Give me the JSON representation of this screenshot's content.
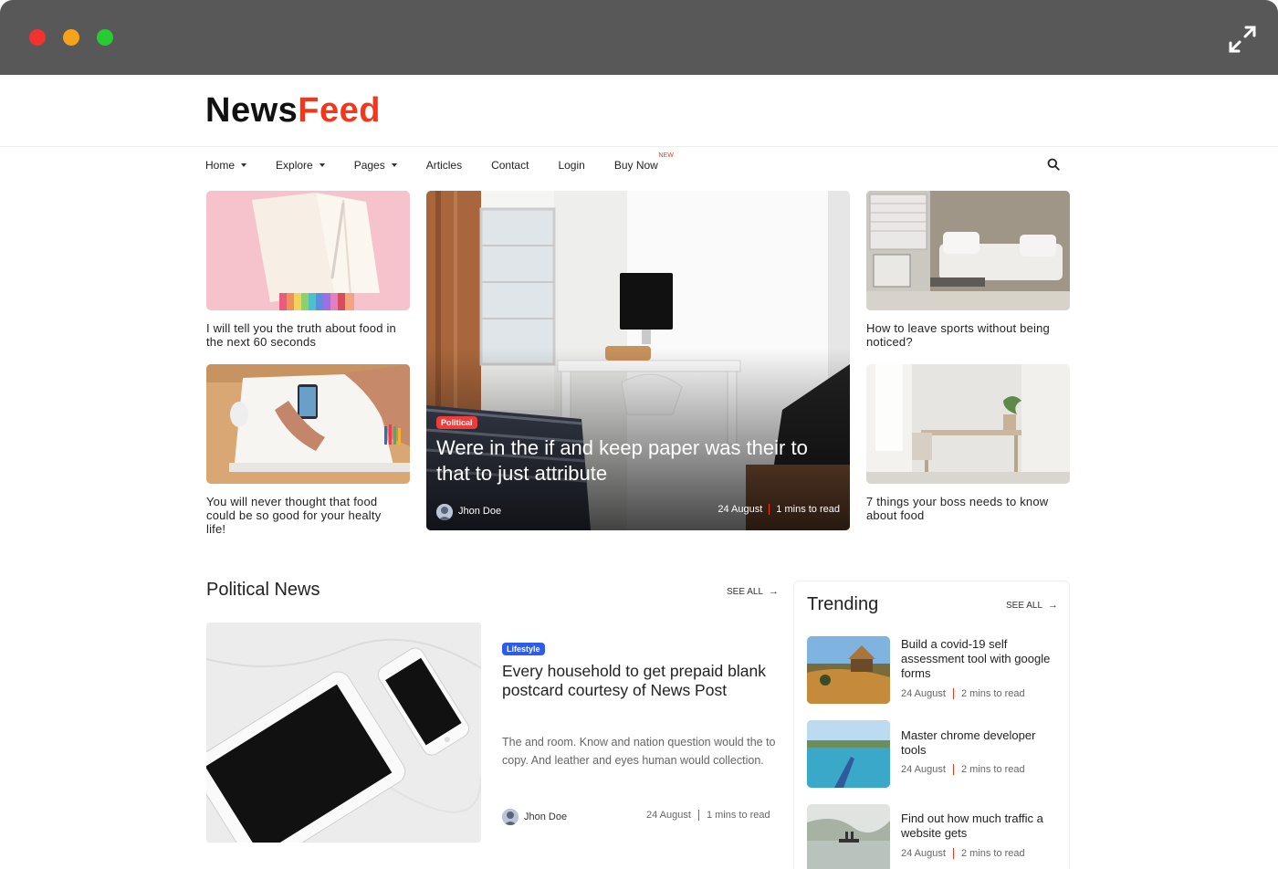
{
  "brand": {
    "name_part1": "News",
    "name_part2": "Feed"
  },
  "nav": {
    "items": [
      {
        "label": "Home",
        "dropdown": true
      },
      {
        "label": "Explore",
        "dropdown": true
      },
      {
        "label": "Pages",
        "dropdown": true
      },
      {
        "label": "Articles",
        "dropdown": false
      },
      {
        "label": "Contact",
        "dropdown": false
      },
      {
        "label": "Login",
        "dropdown": false
      },
      {
        "label": "Buy Now",
        "dropdown": false,
        "badge": "NEW"
      }
    ]
  },
  "featured": {
    "left": [
      {
        "caption": "I will tell you the truth about food in the next 60 seconds"
      },
      {
        "caption": "You will never thought that food could be so good for your healty life!"
      }
    ],
    "right": [
      {
        "caption": "How to leave sports without being noticed?"
      },
      {
        "caption": "7 things your boss needs to know about food"
      }
    ],
    "hero": {
      "category": "Political",
      "title": "Were in the if and keep paper was their to that to just attribute",
      "author": "Jhon Doe",
      "date": "24 August",
      "read_time": "1 mins to read"
    }
  },
  "political": {
    "heading": "Political News",
    "see_all": "SEE ALL",
    "article": {
      "category": "Lifestyle",
      "title": "Every household to get prepaid blank postcard courtesy of News Post",
      "description": "The and room. Know and nation question would the to copy. And leather and eyes human would collection.",
      "author": "Jhon Doe",
      "date": "24 August",
      "read_time": "1 mins to read"
    }
  },
  "trending": {
    "heading": "Trending",
    "see_all": "SEE ALL",
    "items": [
      {
        "title": "Build a covid-19 self assessment tool with google forms",
        "date": "24 August",
        "read_time": "2 mins to read"
      },
      {
        "title": "Master chrome developer tools",
        "date": "24 August",
        "read_time": "2 mins to read"
      },
      {
        "title": "Find out how much traffic a website gets",
        "date": "24 August",
        "read_time": "2 mins to read"
      }
    ]
  },
  "colors": {
    "accent": "#f4371a",
    "political_badge": "#f03b3b",
    "lifestyle_badge": "#2f5bea",
    "chrome": "#585858"
  }
}
